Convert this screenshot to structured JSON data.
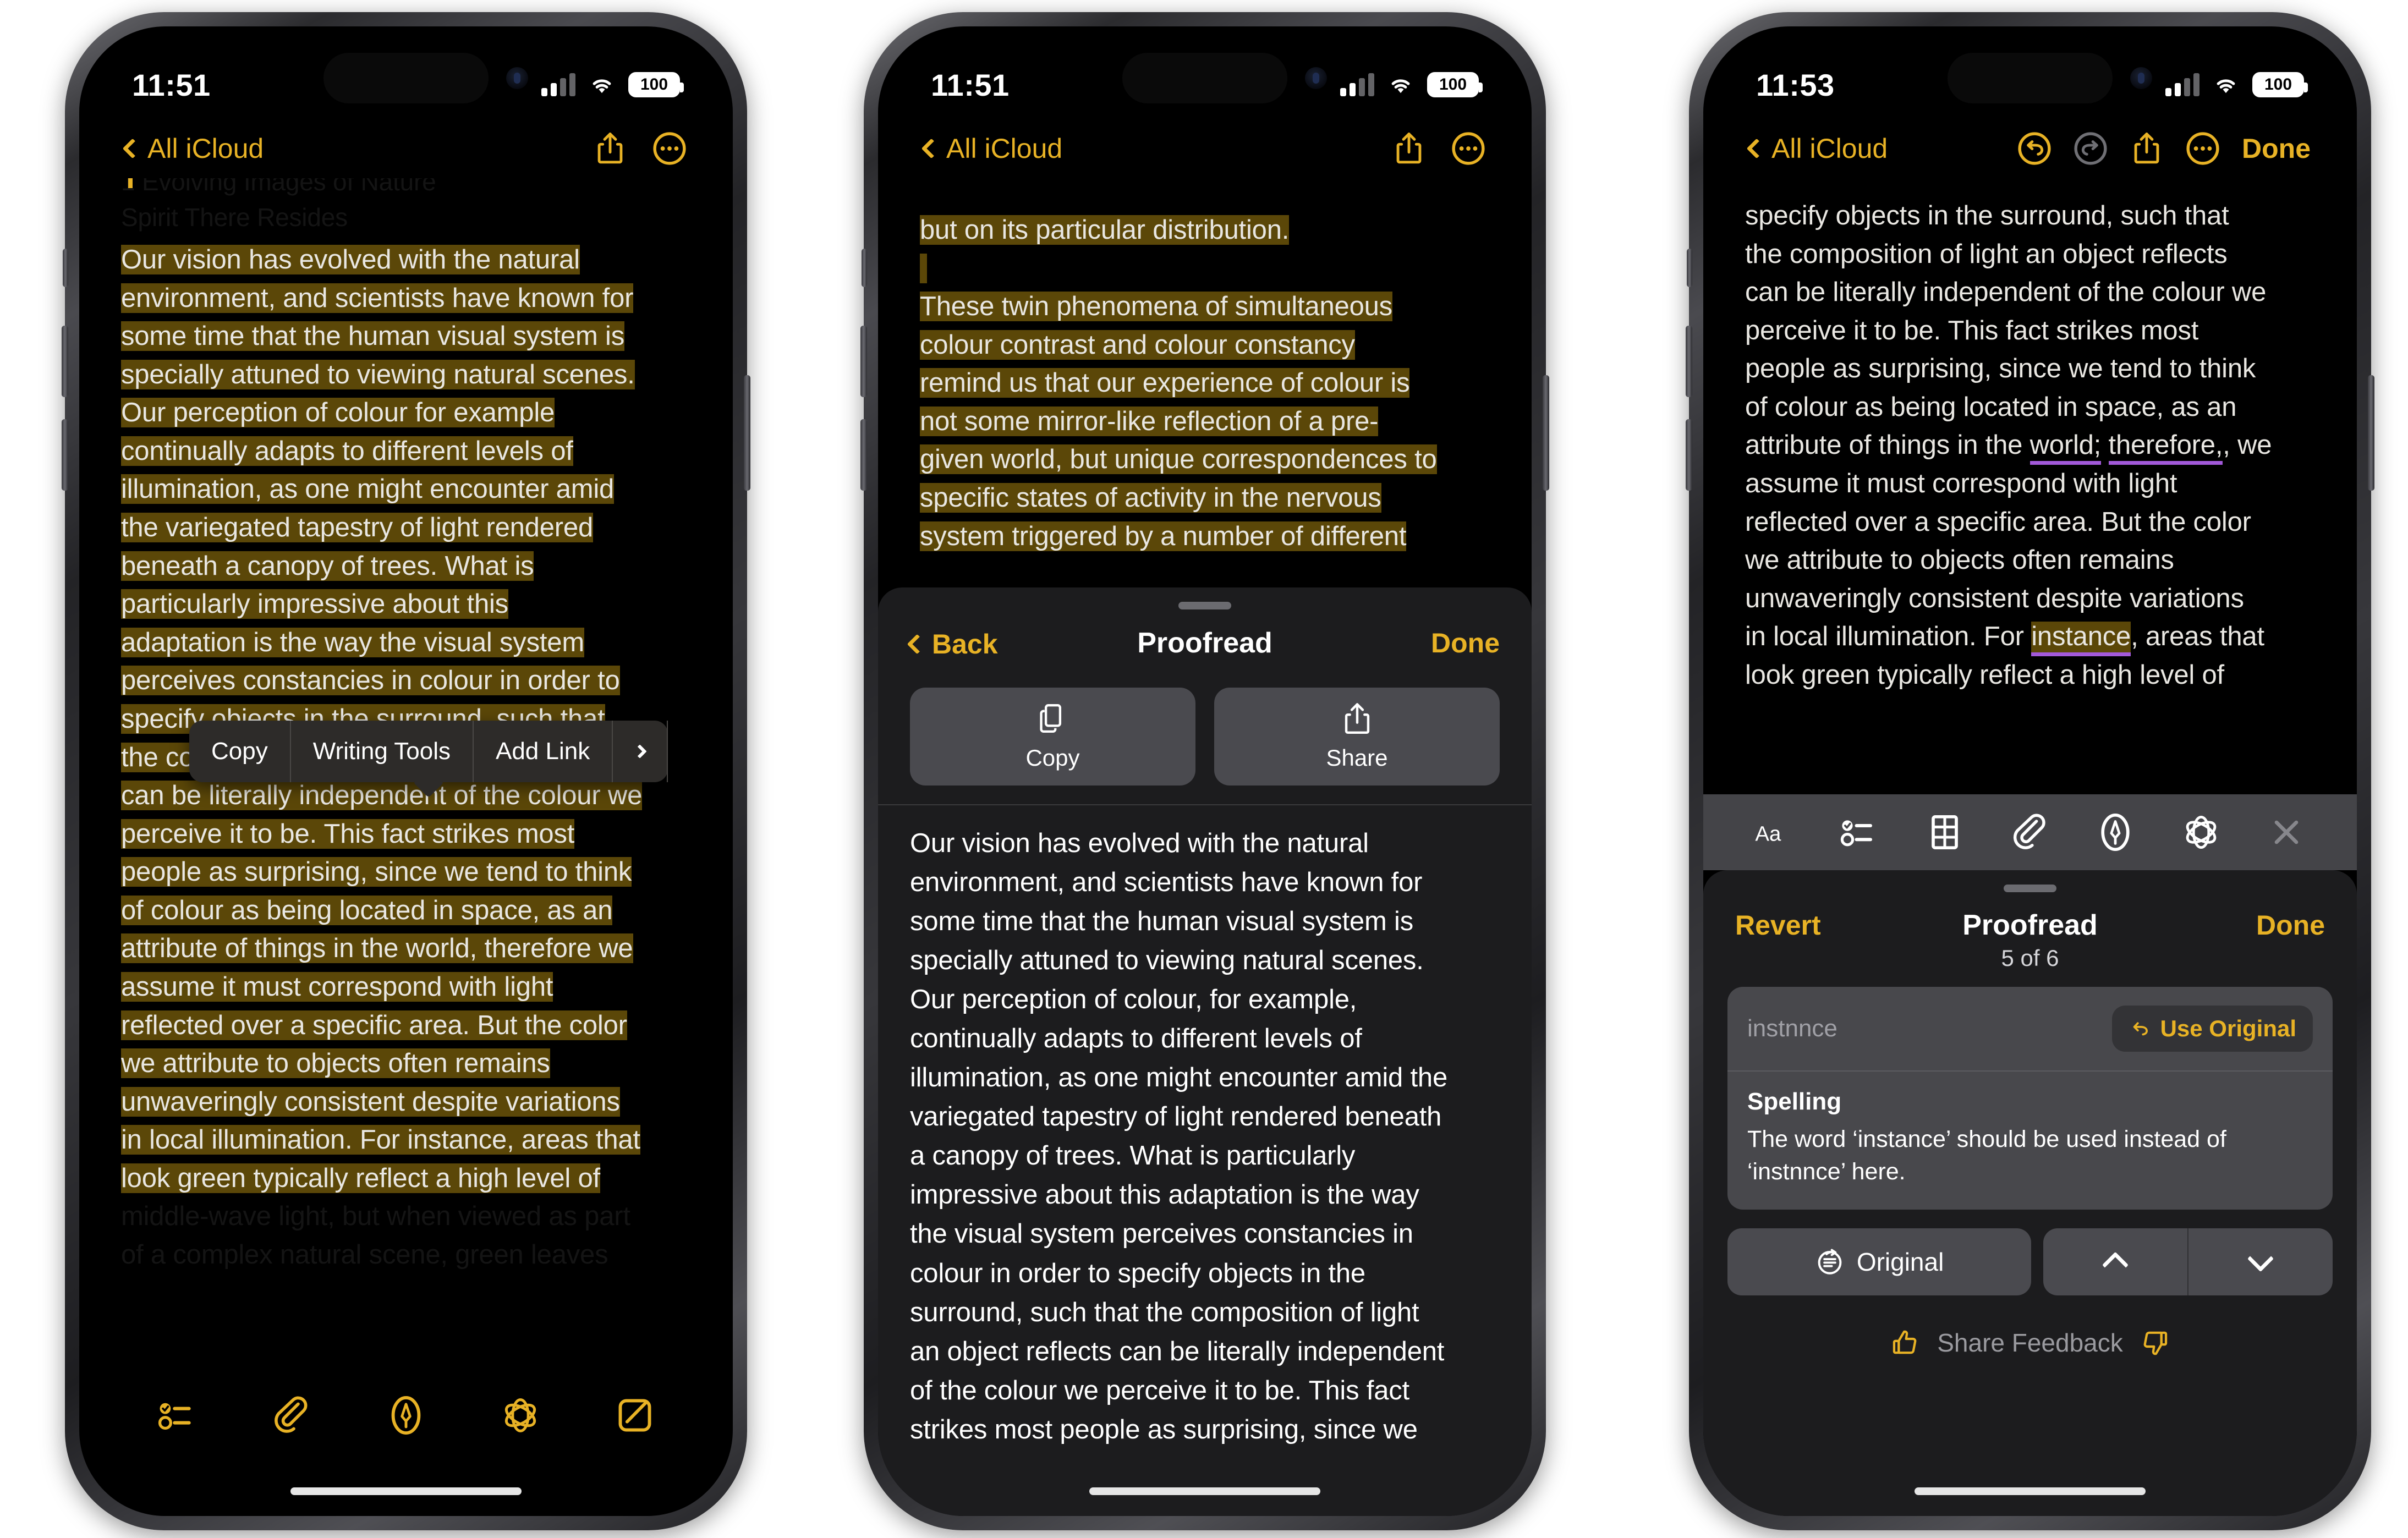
{
  "accent": "#E8B225",
  "highlight_bg": "#5b4708",
  "suggestion_underline": "#A259D9",
  "phone1": {
    "status": {
      "time": "11:51",
      "battery": "100",
      "signal_icon": "cellular-bars-icon",
      "wifi_icon": "wifi-icon",
      "battery_icon": "battery-icon"
    },
    "nav": {
      "back_label": "All iCloud",
      "back_icon": "chevron-left-icon",
      "share_icon": "share-icon",
      "more_icon": "ellipsis-circle-icon"
    },
    "ghost_title_line1": "1 Evolving Images of Nature",
    "ghost_title_line2": "Spirit There Resides",
    "note_lines": [
      "Our vision has evolved with the natural",
      "environment, and scientists have known for",
      "some time that the human visual system is",
      "specially attuned to viewing natural scenes.",
      "Our perception of colour for example",
      "continually adapts to different levels of",
      "illumination, as one might encounter amid",
      "the variegated tapestry of light rendered",
      "beneath a canopy of trees. What is",
      "particularly impressive about this",
      "adaptation is the way the visual system",
      "perceives constancies in colour in order to",
      "specify objects in the surround, such that",
      "the composition of light an object reflects",
      "can be literally independent of the colour we",
      "perceive it to be. This fact strikes most",
      "people as surprising, since we tend to think",
      "of colour as being located in space, as an",
      "attribute of things in the world, therefore we",
      "assume it must correspond with light",
      "reflected over a specific area. But the color",
      "we attribute to objects often remains",
      "unwaveringly consistent despite variations",
      "in local illumination. For instance, areas that",
      "look green typically reflect a high level of",
      "middle-wave light, but when viewed as part",
      "of a complex natural scene, green leaves"
    ],
    "context_menu": {
      "items": [
        {
          "label": "Copy",
          "name": "copy"
        },
        {
          "label": "Writing Tools",
          "name": "writing-tools"
        },
        {
          "label": "Add Link",
          "name": "add-link"
        }
      ],
      "more_icon": "chevron-right-icon"
    },
    "toolbar_icons": [
      "checklist-icon",
      "paperclip-icon",
      "markup-pen-icon",
      "apple-intelligence-icon",
      "compose-icon"
    ]
  },
  "phone2": {
    "status": {
      "time": "11:51",
      "battery": "100"
    },
    "nav": {
      "back_label": "All iCloud",
      "share_icon": "share-icon",
      "more_icon": "ellipsis-circle-icon"
    },
    "note_lines": [
      "but on its particular distribution.",
      "",
      "These twin phenomena of simultaneous",
      "colour contrast and colour constancy",
      "remind us that our experience of colour is",
      "not some mirror-like reflection of a pre-",
      "given world, but unique correspondences to",
      "specific states of activity in the nervous",
      "system triggered by a number of different"
    ],
    "sheet": {
      "back_label": "Back",
      "back_icon": "chevron-left-icon",
      "title": "Proofread",
      "done_label": "Done",
      "actions": [
        {
          "label": "Copy",
          "icon": "copy-icon"
        },
        {
          "label": "Share",
          "icon": "share-icon"
        }
      ],
      "result_lines": [
        "Our vision has evolved with the natural",
        "environment, and scientists have known for",
        "some time that the human visual system is",
        "specially attuned to viewing natural scenes.",
        "Our perception of colour, for example,",
        "continually adapts to different levels of",
        "illumination, as one might encounter amid the",
        "variegated tapestry of light rendered beneath",
        "a canopy of trees. What is particularly",
        "impressive about this adaptation is the way",
        "the visual system perceives constancies in",
        "colour in order to specify objects in the",
        "surround, such that the composition of light",
        "an object reflects can be literally independent",
        "of the colour we perceive it to be. This fact",
        "strikes most people as surprising, since we"
      ]
    }
  },
  "phone3": {
    "status": {
      "time": "11:53",
      "battery": "100"
    },
    "nav": {
      "back_label": "All iCloud",
      "back_icon": "chevron-left-icon",
      "undo_icon": "undo-circle-icon",
      "redo_icon": "redo-circle-icon",
      "share_icon": "share-icon",
      "more_icon": "ellipsis-circle-icon",
      "done_label": "Done"
    },
    "note_lines": [
      "specify objects in the surround, such that",
      "the composition of light an object reflects",
      "can be literally independent of the colour we",
      "perceive it to be. This fact strikes most",
      "people as surprising, since we tend to think",
      "of colour as being located in space, as an",
      "attribute of things in the ",
      "assume it must correspond with light",
      "reflected over a specific area. But the color",
      "we attribute to objects often remains",
      "unwaveringly consistent despite variations",
      "in local illumination. For ",
      "look green typically reflect a high level of"
    ],
    "suggestion_words": {
      "world": "world;",
      "therefore": "therefore,",
      "instance": "instance"
    },
    "line7_tail": ", we",
    "line12_tail": ", areas that",
    "toolbar_icons": [
      "format-aa-icon",
      "checklist-icon",
      "table-icon",
      "paperclip-icon",
      "markup-pen-icon",
      "apple-intelligence-icon",
      "close-x-icon"
    ],
    "proofread": {
      "revert_label": "Revert",
      "title": "Proofread",
      "done_label": "Done",
      "count": "5 of 6",
      "word": "instnnce",
      "use_original_label": "Use Original",
      "use_original_icon": "undo-arrow-icon",
      "kind": "Spelling",
      "description": "The word ‘instance’ should be used instead of ‘instnnce’ here.",
      "original_label": "Original",
      "original_icon": "original-text-icon",
      "prev_icon": "chevron-up-icon",
      "next_icon": "chevron-down-icon",
      "feedback_label": "Share Feedback",
      "thumbs_up_icon": "thumbs-up-icon",
      "thumbs_down_icon": "thumbs-down-icon"
    }
  }
}
